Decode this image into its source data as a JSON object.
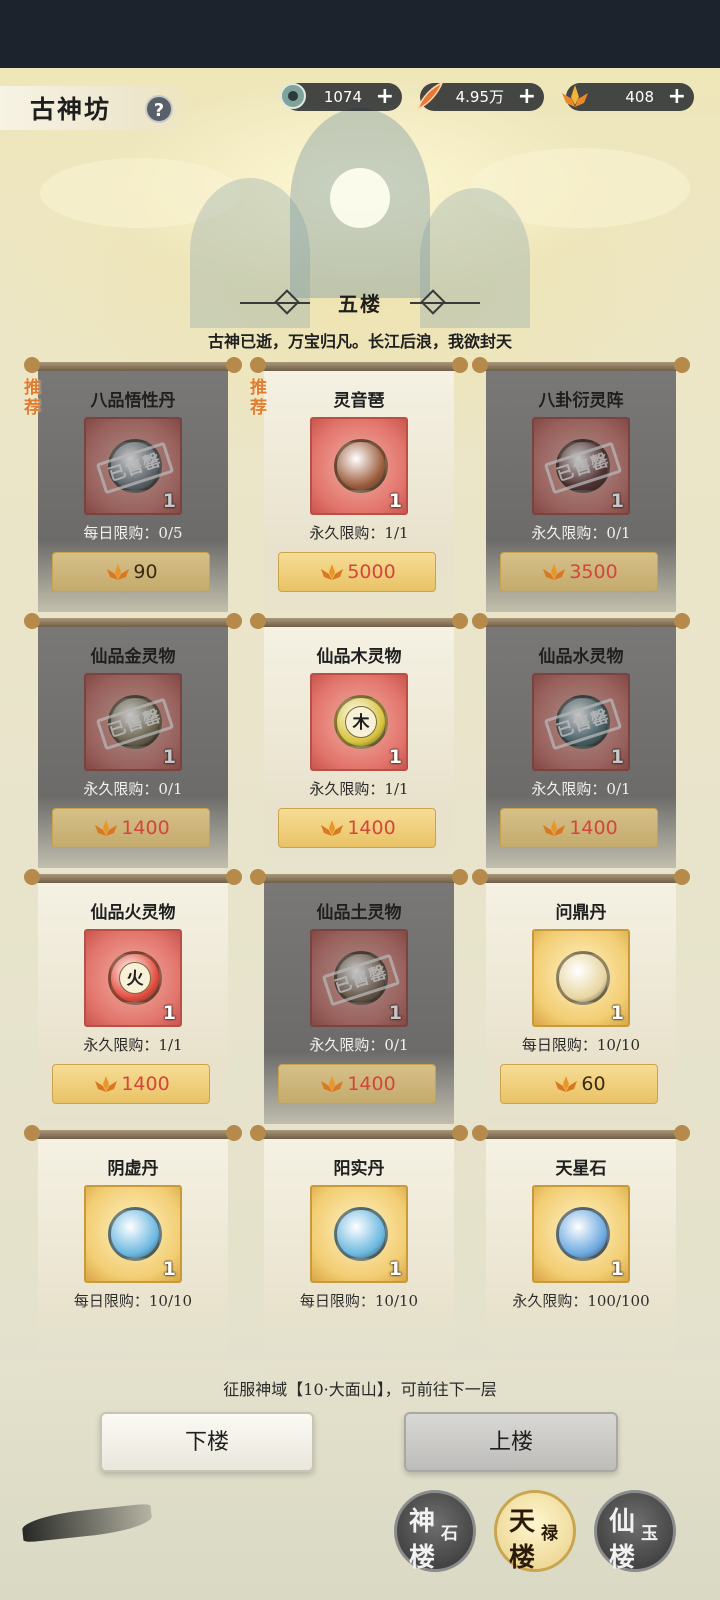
{
  "page": {
    "title": "古神坊",
    "help_label": "?"
  },
  "currencies": [
    {
      "icon": "jade-token-icon",
      "value": "1074",
      "add_label": "+"
    },
    {
      "icon": "feather-icon",
      "value": "4.95万",
      "add_label": "+"
    },
    {
      "icon": "lotus-icon",
      "value": "408",
      "add_label": "+"
    }
  ],
  "floor": {
    "title": "五楼",
    "description": "古神已逝，万宝归凡。长江后浪，我欲封天"
  },
  "sold_stamp": "已售罄",
  "recommend_tag": "推荐",
  "items": [
    {
      "name": "八品悟性丹",
      "qty": "1",
      "limit": "每日限购：0/5",
      "price": "90",
      "sold": true,
      "recommended": true,
      "price_red": false,
      "orb_color": "#6d7c8a",
      "orb_char": ""
    },
    {
      "name": "灵音琶",
      "qty": "1",
      "limit": "永久限购：1/1",
      "price": "5000",
      "sold": false,
      "recommended": true,
      "price_red": true,
      "orb_color": "#9a5a3a",
      "orb_char": ""
    },
    {
      "name": "八卦衍灵阵",
      "qty": "1",
      "limit": "永久限购：0/1",
      "price": "3500",
      "sold": true,
      "recommended": false,
      "price_red": true,
      "orb_color": "#7a3a3a",
      "orb_char": ""
    },
    {
      "name": "仙品金灵物",
      "qty": "1",
      "limit": "永久限购：0/1",
      "price": "1400",
      "sold": true,
      "recommended": false,
      "price_red": true,
      "orb_color": "#8a7a50",
      "orb_char": ""
    },
    {
      "name": "仙品木灵物",
      "qty": "1",
      "limit": "永久限购：1/1",
      "price": "1400",
      "sold": false,
      "recommended": false,
      "price_red": true,
      "orb_color": "#d8c23a",
      "orb_char": "木"
    },
    {
      "name": "仙品水灵物",
      "qty": "1",
      "limit": "永久限购：0/1",
      "price": "1400",
      "sold": true,
      "recommended": false,
      "price_red": true,
      "orb_color": "#4a7a8a",
      "orb_char": ""
    },
    {
      "name": "仙品火灵物",
      "qty": "1",
      "limit": "永久限购：1/1",
      "price": "1400",
      "sold": false,
      "recommended": false,
      "price_red": true,
      "orb_color": "#e24a3a",
      "orb_char": "火"
    },
    {
      "name": "仙品土灵物",
      "qty": "1",
      "limit": "永久限购：0/1",
      "price": "1400",
      "sold": true,
      "recommended": false,
      "price_red": true,
      "orb_color": "#8a6a50",
      "orb_char": ""
    },
    {
      "name": "问鼎丹",
      "qty": "1",
      "limit": "每日限购：10/10",
      "price": "60",
      "sold": false,
      "recommended": false,
      "price_red": false,
      "orb_color": "#e8d6a0",
      "orb_char": ""
    },
    {
      "name": "阴虚丹",
      "qty": "1",
      "limit": "每日限购：10/10",
      "price": "",
      "sold": false,
      "recommended": false,
      "price_red": false,
      "orb_color": "#6ab7e0",
      "orb_char": ""
    },
    {
      "name": "阳实丹",
      "qty": "1",
      "limit": "每日限购：10/10",
      "price": "",
      "sold": false,
      "recommended": false,
      "price_red": false,
      "orb_color": "#6ab7e0",
      "orb_char": ""
    },
    {
      "name": "天星石",
      "qty": "1",
      "limit": "永久限购：100/100",
      "price": "",
      "sold": false,
      "recommended": false,
      "price_red": false,
      "orb_color": "#6aa8e0",
      "orb_char": ""
    }
  ],
  "footer": {
    "note": "征服神域【10·大面山】，可前往下一层",
    "down_label": "下楼",
    "up_label": "上楼"
  },
  "towers": [
    {
      "char_a": "神",
      "char_b": "石",
      "char_c": "楼",
      "active": false
    },
    {
      "char_a": "天",
      "char_b": "禄",
      "char_c": "楼",
      "active": true
    },
    {
      "char_a": "仙",
      "char_b": "玉",
      "char_c": "楼",
      "active": false
    }
  ]
}
